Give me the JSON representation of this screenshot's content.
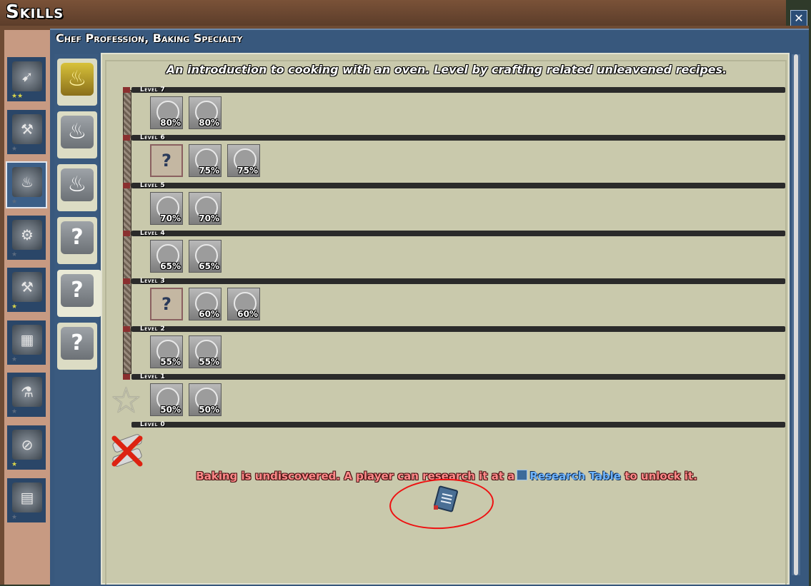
{
  "window": {
    "title": "Skills",
    "close_symbol": "✕"
  },
  "panel": {
    "subtitle": "Chef Profession, Baking Specialty"
  },
  "sidebar": {
    "items": [
      {
        "icon": "crossbow-icon",
        "glyph": "➹",
        "stars": "★★",
        "stars_active": true
      },
      {
        "icon": "anvil-icon",
        "glyph": "⚒",
        "stars": "★",
        "stars_active": false
      },
      {
        "icon": "cooking-pot-icon",
        "glyph": "♨",
        "stars": "★",
        "stars_active": false
      },
      {
        "icon": "engine-icon",
        "glyph": "⚙",
        "stars": "★",
        "stars_active": false
      },
      {
        "icon": "workbench-icon",
        "glyph": "⚒",
        "stars": "★",
        "stars_active": true
      },
      {
        "icon": "stone-blocks-icon",
        "glyph": "▦",
        "stars": "★",
        "stars_active": false
      },
      {
        "icon": "smelter-icon",
        "glyph": "⚗",
        "stars": "★",
        "stars_active": false
      },
      {
        "icon": "sawmill-icon",
        "glyph": "⊘",
        "stars": "★",
        "stars_active": true
      },
      {
        "icon": "paper-roll-icon",
        "glyph": "▤",
        "stars": "★",
        "stars_active": false
      }
    ]
  },
  "specialties": [
    {
      "icon": "campfire-icon",
      "glyph": "♨"
    },
    {
      "icon": "cooking-pot-icon",
      "glyph": "♨"
    },
    {
      "icon": "cooking-pot-icon",
      "glyph": "♨"
    },
    {
      "icon": "question-icon",
      "glyph": "?"
    },
    {
      "icon": "question-icon",
      "glyph": "?"
    },
    {
      "icon": "question-icon",
      "glyph": "?"
    }
  ],
  "description": "An introduction to cooking with an oven. Level by crafting related unleavened recipes.",
  "levels": [
    {
      "label": "Level 7",
      "talents": [
        {
          "type": "dial",
          "pct": "80%"
        },
        {
          "type": "stars",
          "pct": "80%"
        }
      ]
    },
    {
      "label": "Level 6",
      "talents": [
        {
          "type": "unknown",
          "pct": "?"
        },
        {
          "type": "dial",
          "pct": "75%"
        },
        {
          "type": "stars",
          "pct": "75%"
        }
      ]
    },
    {
      "label": "Level 5",
      "talents": [
        {
          "type": "dial",
          "pct": "70%"
        },
        {
          "type": "stars",
          "pct": "70%"
        }
      ]
    },
    {
      "label": "Level 4",
      "talents": [
        {
          "type": "dial",
          "pct": "65%"
        },
        {
          "type": "stars",
          "pct": "65%"
        }
      ]
    },
    {
      "label": "Level 3",
      "talents": [
        {
          "type": "unknown",
          "pct": "?"
        },
        {
          "type": "dial",
          "pct": "60%"
        },
        {
          "type": "stars",
          "pct": "60%"
        }
      ]
    },
    {
      "label": "Level 2",
      "talents": [
        {
          "type": "dial",
          "pct": "55%"
        },
        {
          "type": "stars",
          "pct": "55%"
        }
      ]
    },
    {
      "label": "Level 1",
      "talents": [
        {
          "type": "dial",
          "pct": "50%"
        },
        {
          "type": "stars",
          "pct": "50%"
        }
      ]
    },
    {
      "label": "Level 0",
      "talents": []
    }
  ],
  "undiscovered": {
    "prefix": "Baking is undiscovered. A player can research it at a",
    "link": "Research Table",
    "suffix": "to unlock it."
  },
  "colors": {
    "message": "#ff8a8a",
    "link": "#6fb4ff",
    "annotation_circle": "#ee1111"
  }
}
